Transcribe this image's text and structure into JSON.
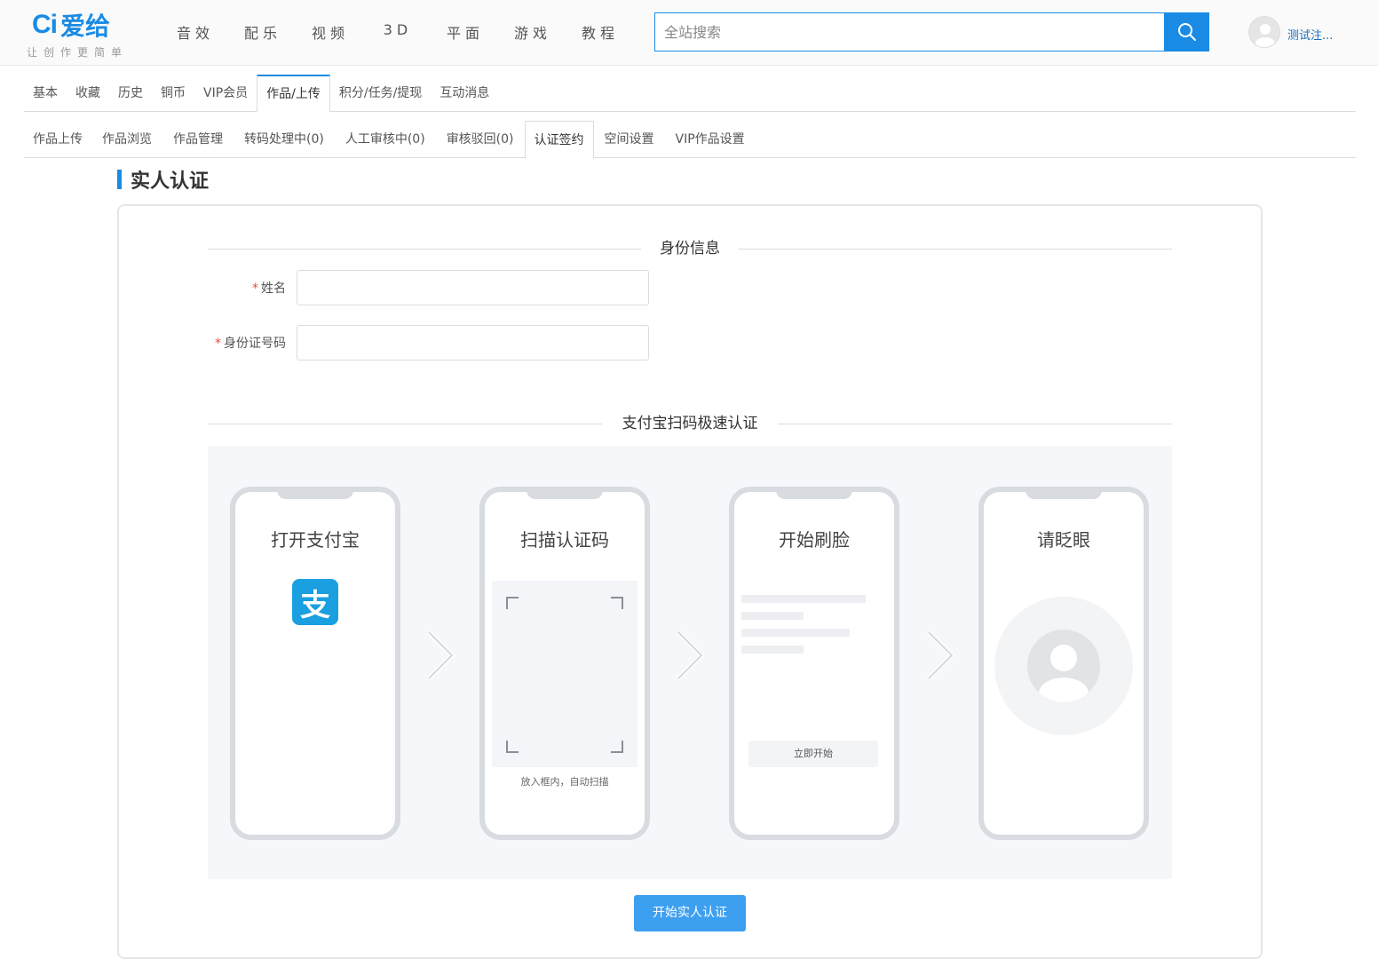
{
  "header": {
    "logo_ci": "Ci",
    "logo_name": "爱给",
    "logo_slogan": "让创作更简单",
    "nav": [
      "音效",
      "配乐",
      "视频",
      "3D",
      "平面",
      "游戏",
      "教程"
    ],
    "search_placeholder": "全站搜索",
    "username": "测试注..."
  },
  "tabs_primary": [
    "基本",
    "收藏",
    "历史",
    "铜币",
    "VIP会员",
    "作品/上传",
    "积分/任务/提现",
    "互动消息"
  ],
  "tabs_primary_active": "作品/上传",
  "tabs_secondary": [
    "作品上传",
    "作品浏览",
    "作品管理",
    "转码处理中(0)",
    "人工审核中(0)",
    "审核驳回(0)",
    "认证签约",
    "空间设置",
    "VIP作品设置"
  ],
  "tabs_secondary_active": "认证签约",
  "page_title": "实人认证",
  "identity": {
    "section_title": "身份信息",
    "name_label": "姓名",
    "name_value": "",
    "id_label": "身份证号码",
    "id_value": "",
    "required_mark": "*"
  },
  "alipay": {
    "section_title": "支付宝扫码极速认证",
    "steps": [
      {
        "title": "打开支付宝",
        "icon": "alipay-icon"
      },
      {
        "title": "扫描认证码",
        "tip": "放入框内，自动扫描"
      },
      {
        "title": "开始刷脸",
        "button": "立即开始"
      },
      {
        "title": "请眨眼",
        "icon": "face-icon"
      }
    ]
  },
  "submit_label": "开始实人认证",
  "colors": {
    "brand": "#1a8be4",
    "button": "#3d9ff0",
    "alipay": "#1a9fe0",
    "required": "#e74c3c"
  }
}
